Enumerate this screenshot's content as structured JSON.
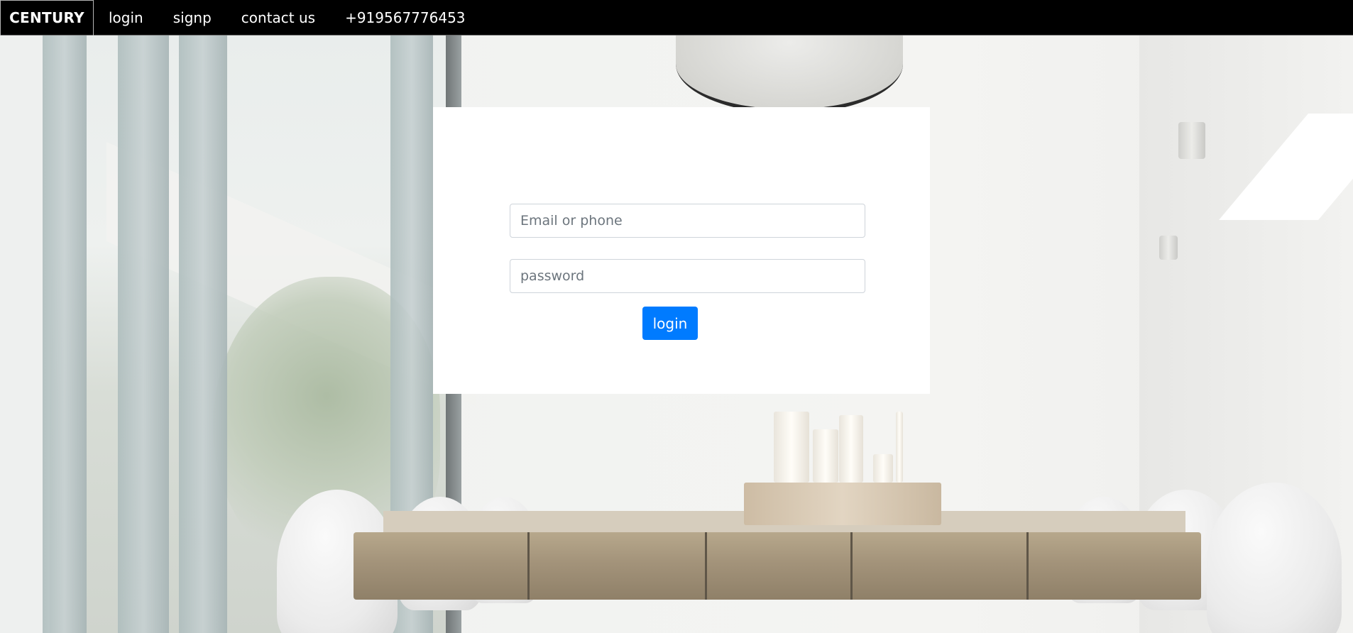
{
  "navbar": {
    "brand": "CENTURY",
    "links": {
      "login": "login",
      "signup": "signp",
      "contact": "contact us",
      "phone": "+919567776453"
    }
  },
  "login_form": {
    "email_placeholder": "Email or phone",
    "password_placeholder": "password",
    "submit_label": "login",
    "submit_color": "#007bff"
  },
  "background": {
    "description_icon": "dining-room-photo"
  }
}
